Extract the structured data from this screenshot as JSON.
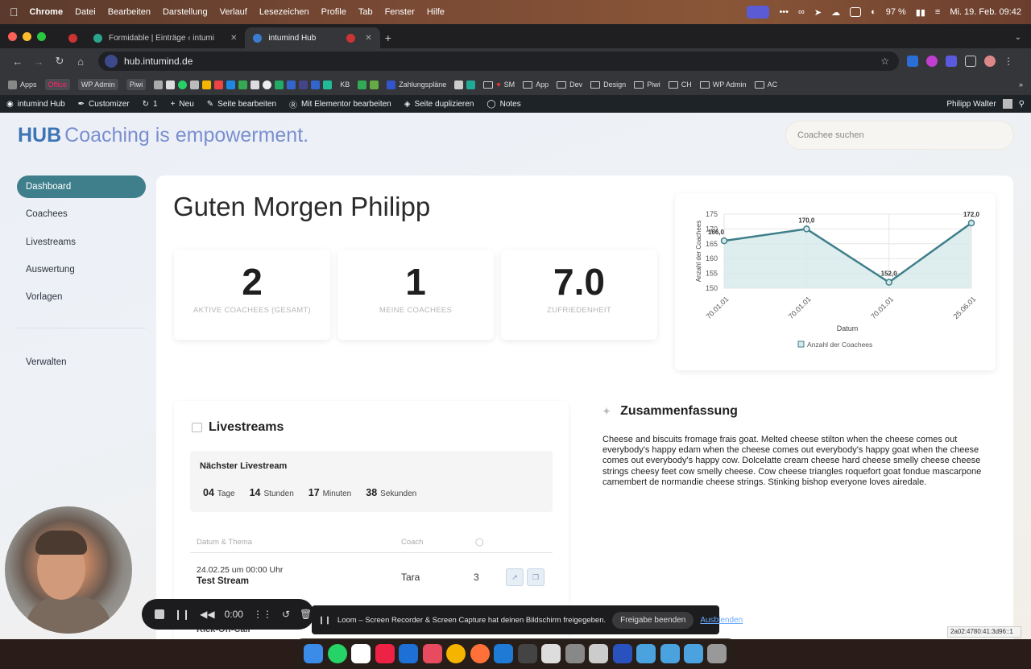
{
  "menubar": {
    "items": [
      "Chrome",
      "Datei",
      "Bearbeiten",
      "Darstellung",
      "Verlauf",
      "Lesezeichen",
      "Profile",
      "Tab",
      "Fenster",
      "Hilfe"
    ],
    "battery": "97 %",
    "datetime": "Mi. 19. Feb.  09:42"
  },
  "tabs": [
    {
      "title": "Formidable | Einträge ‹ intumi"
    },
    {
      "title": "intumind Hub"
    }
  ],
  "address": {
    "url": "hub.intumind.de"
  },
  "bookmarks": [
    "Apps",
    "Office",
    "WP Admin",
    "Piwi",
    "KB",
    "Zahlungspläne",
    "SM",
    "App",
    "Dev",
    "Design",
    "Piwi",
    "CH",
    "WP Admin",
    "AC"
  ],
  "wpbar": {
    "site": "intumind Hub",
    "customizer": "Customizer",
    "updates": "1",
    "new": "Neu",
    "edit": "Seite bearbeiten",
    "elementor": "Mit Elementor bearbeiten",
    "duplicate": "Seite duplizieren",
    "notes": "Notes",
    "user": "Philipp Walter"
  },
  "brand": {
    "bold": "HUB",
    "tagline": "Coaching is empowerment."
  },
  "search": {
    "placeholder": "Coachee suchen"
  },
  "nav": {
    "items": [
      "Dashboard",
      "Coachees",
      "Livestreams",
      "Auswertung",
      "Vorlagen"
    ],
    "manage": "Verwalten"
  },
  "greeting": "Guten Morgen Philipp",
  "stats": [
    {
      "value": "2",
      "label": "AKTIVE COACHEES (GESAMT)"
    },
    {
      "value": "1",
      "label": "MEINE COACHEES"
    },
    {
      "value": "7.0",
      "label": "ZUFRIEDENHEIT"
    }
  ],
  "chart_data": {
    "type": "area",
    "categories": [
      "70.01.01",
      "70.01.01",
      "70.01.01",
      "25.06.01"
    ],
    "series": [
      {
        "name": "Anzahl der Coachees",
        "values": [
          166.0,
          170.0,
          152.0,
          172.0
        ]
      }
    ],
    "data_labels": [
      "166,0",
      "170,0",
      "152,0",
      "172,0"
    ],
    "xlabel": "Datum",
    "ylabel": "Anzahl der Coachees",
    "yticks": [
      150,
      155,
      160,
      165,
      170,
      175
    ],
    "ylim": [
      150,
      175
    ],
    "grid": true,
    "legend": "bottom",
    "color": "#3f7f8b",
    "fill": "#d6e8ea"
  },
  "livestreams": {
    "title": "Livestreams",
    "next_title": "Nächster Livestream",
    "countdown": [
      {
        "value": "04",
        "unit": "Tage"
      },
      {
        "value": "14",
        "unit": "Stunden"
      },
      {
        "value": "17",
        "unit": "Minuten"
      },
      {
        "value": "38",
        "unit": "Sekunden"
      }
    ],
    "columns": [
      "Datum & Thema",
      "Coach"
    ],
    "rows": [
      {
        "date": "24.02.25 um 00:00 Uhr",
        "name": "Test Stream",
        "coach": "Tara",
        "count": "3"
      }
    ],
    "partial_row": "Kick-Off-Call"
  },
  "summary": {
    "title": "Zusammenfassung",
    "text": "Cheese and biscuits fromage frais goat. Melted cheese stilton when the cheese comes out everybody's happy edam when the cheese comes out everybody's happy goat when the cheese comes out everybody's happy cow. Dolcelatte cream cheese hard cheese smelly cheese cheese strings cheesy feet cow smelly cheese. Cow cheese triangles roquefort goat fondue mascarpone camembert de normandie cheese strings. Stinking bishop everyone loves airedale."
  },
  "loom": {
    "time": "0:00",
    "message": "Loom – Screen Recorder & Screen Capture hat deinen Bildschirm freigegeben.",
    "stop_share": "Freigabe beenden",
    "hide": "Ausblenden"
  },
  "ipv6": "2a02:4780:41:3d96::1"
}
